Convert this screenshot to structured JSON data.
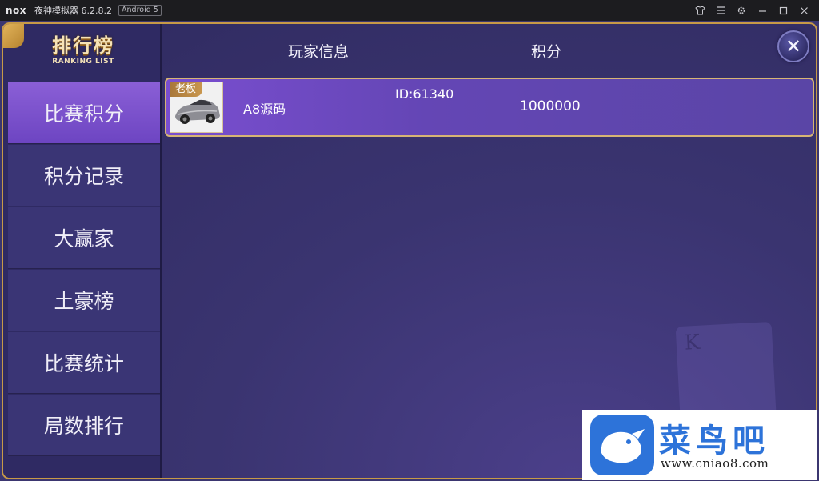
{
  "titlebar": {
    "logo": "nox",
    "title": "夜神模拟器 6.2.8.2",
    "badge": "Android 5",
    "icons": [
      "shirt-icon",
      "menu-icon",
      "gear-icon",
      "minimize-icon",
      "maximize-icon",
      "close-icon"
    ]
  },
  "logo": {
    "cn": "排行榜",
    "en": "RANKING LIST"
  },
  "menu": [
    {
      "label": "比赛积分",
      "active": true
    },
    {
      "label": "积分记录",
      "active": false
    },
    {
      "label": "大赢家",
      "active": false
    },
    {
      "label": "土豪榜",
      "active": false
    },
    {
      "label": "比赛统计",
      "active": false
    },
    {
      "label": "局数排行",
      "active": false
    }
  ],
  "header": {
    "player_info": "玩家信息",
    "score": "积分",
    "close_glyph": "✕"
  },
  "rows": [
    {
      "tag": "老板",
      "name": "A8源码",
      "id": "ID:61340",
      "score": "1000000"
    }
  ],
  "card": {
    "rank": "K"
  },
  "watermark": {
    "cn": "菜鸟吧",
    "url": "www.cniao8.com"
  },
  "colors": {
    "accent_gold": "#c79a47",
    "active_tab": "#7a4ed0",
    "panel": "#3a3470",
    "watermark_blue": "#2d73d9"
  }
}
